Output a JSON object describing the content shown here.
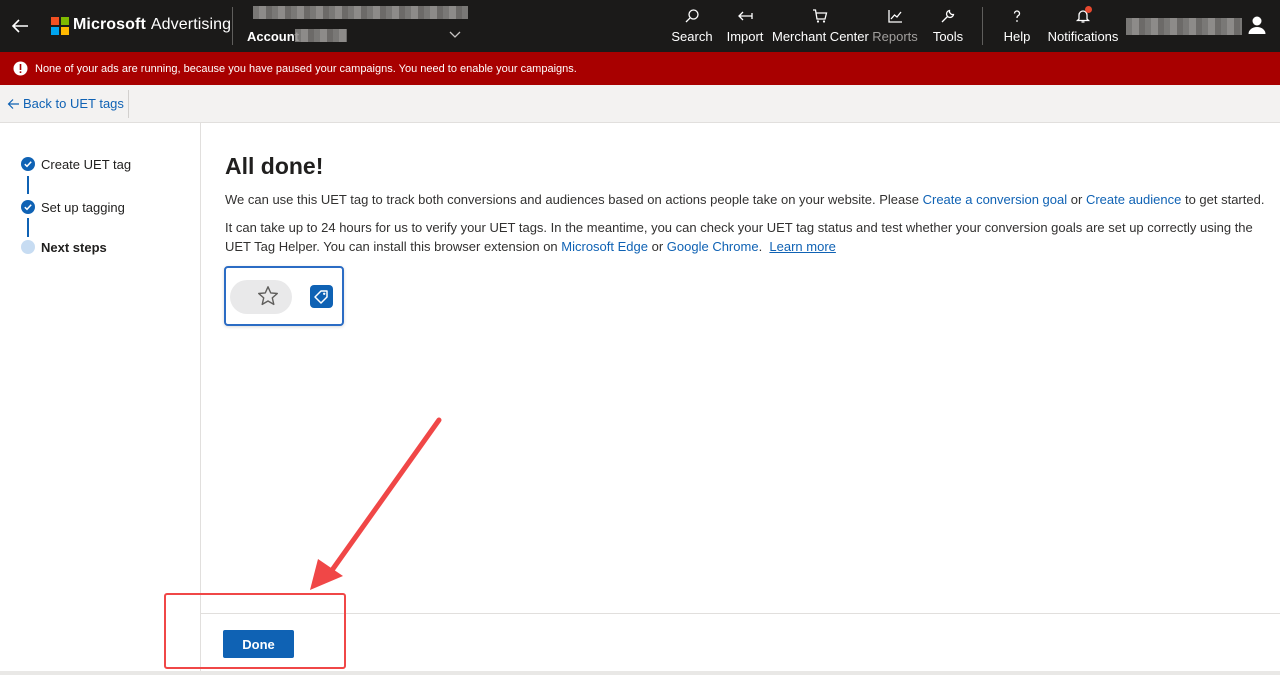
{
  "header": {
    "brand_name": "Microsoft",
    "product_name": "Advertising",
    "account_label": "Account",
    "nav": [
      {
        "label": "Search",
        "icon": "search-icon"
      },
      {
        "label": "Import",
        "icon": "import-icon"
      },
      {
        "label": "Merchant Center",
        "icon": "cart-icon"
      },
      {
        "label": "Reports",
        "icon": "chart-icon"
      },
      {
        "label": "Tools",
        "icon": "wrench-icon"
      },
      {
        "label": "Help",
        "icon": "question-icon"
      },
      {
        "label": "Notifications",
        "icon": "bell-icon"
      }
    ],
    "notification_dot_color": "#e8482e"
  },
  "alert": {
    "text": "None of your ads are running, because you have paused your campaigns. You need to enable your campaigns.",
    "color": "#a80000"
  },
  "back_link": "Back to UET tags",
  "stepper": {
    "steps": [
      {
        "label": "Create UET tag",
        "state": "complete"
      },
      {
        "label": "Set up tagging",
        "state": "complete"
      },
      {
        "label": "Next steps",
        "state": "current"
      }
    ]
  },
  "main": {
    "title": "All done!",
    "p1": {
      "before": "We can use this UET tag to track both conversions and audiences based on actions people take on your website. Please ",
      "link1": "Create a conversion goal",
      "mid": " or ",
      "link2": "Create audience",
      "after": " to get started."
    },
    "p2": {
      "before": "It can take up to 24 hours for us to verify your UET tags. In the meantime, you can check your UET tag status and test whether your conversion goals are set up correctly using the UET Tag Helper. You can install this browser extension on ",
      "link1": "Microsoft Edge",
      "mid": " or ",
      "link2": "Google Chrome",
      "after": ".  ",
      "learn_more": "Learn more"
    },
    "done_label": "Done"
  },
  "colors": {
    "accent": "#0f62b4",
    "topbar": "#1b1a19",
    "annotation": "#f04747"
  }
}
